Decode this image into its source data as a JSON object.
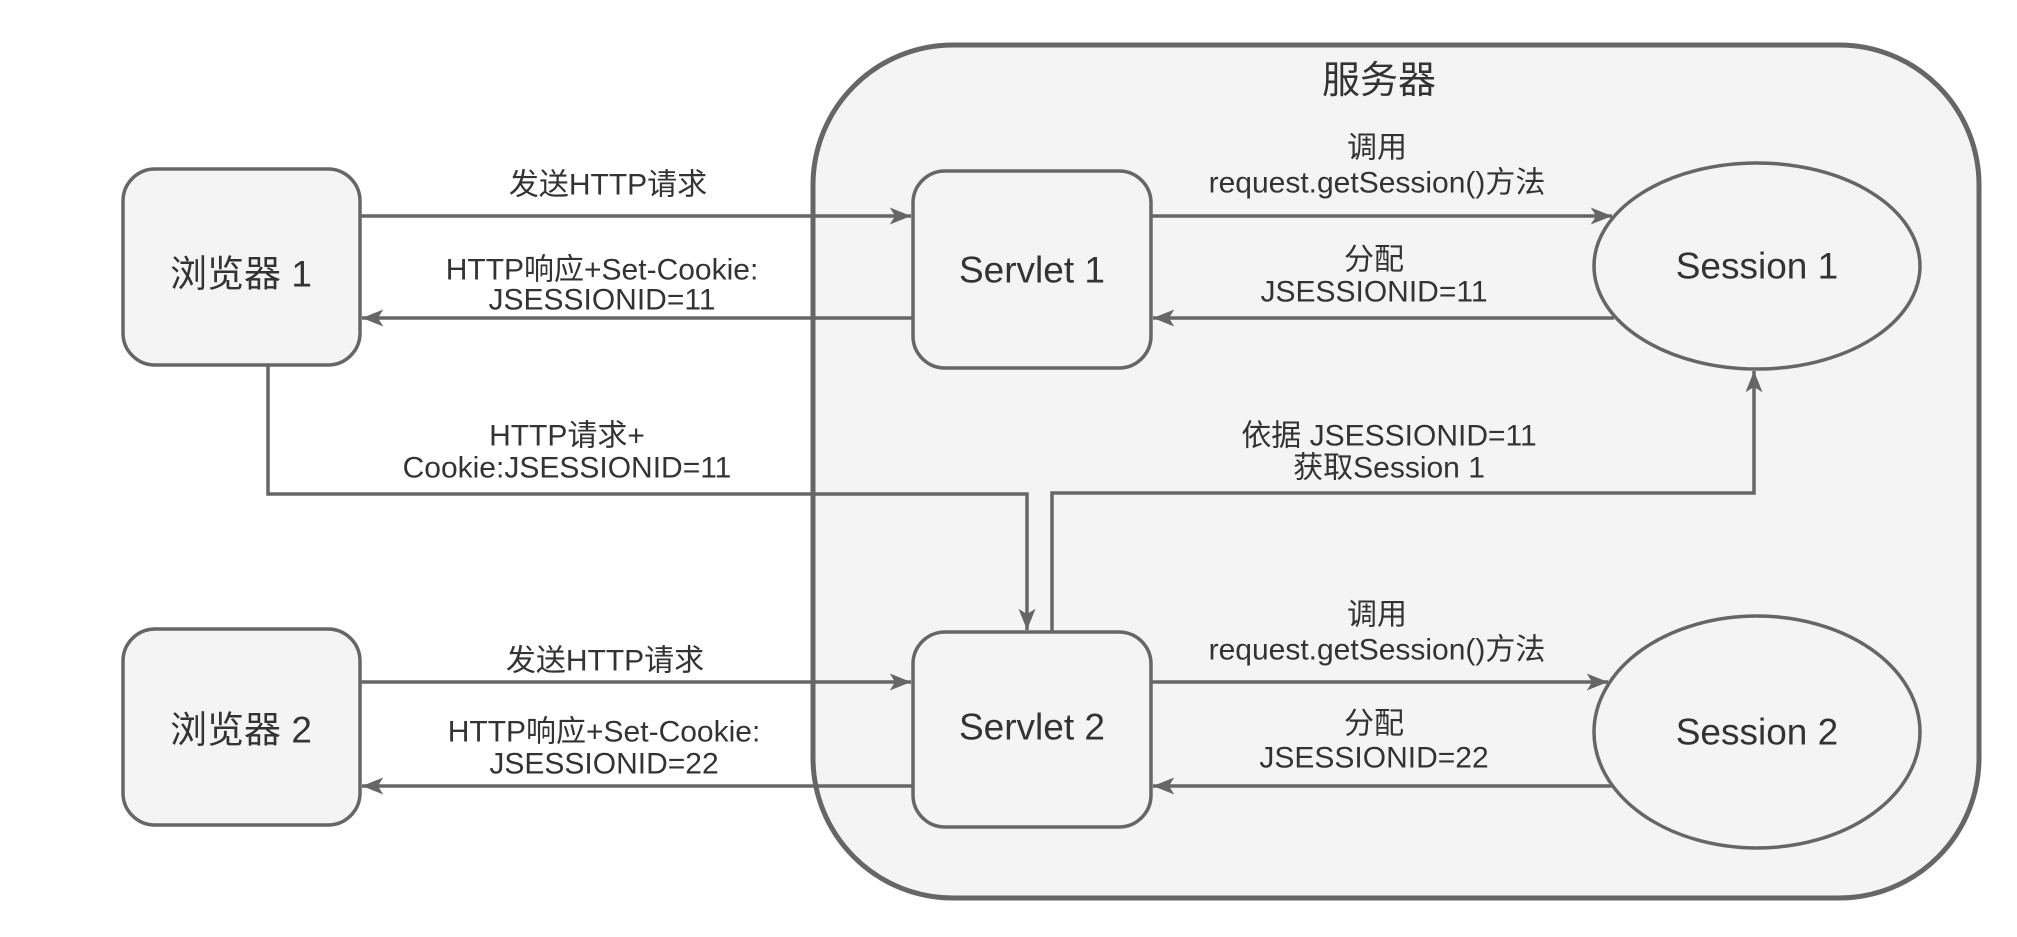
{
  "server": {
    "title": "服务器"
  },
  "browsers": [
    {
      "label": "浏览器 1"
    },
    {
      "label": "浏览器 2"
    }
  ],
  "servlets": [
    {
      "label": "Servlet 1"
    },
    {
      "label": "Servlet 2"
    }
  ],
  "sessions": [
    {
      "label": "Session 1"
    },
    {
      "label": "Session 2"
    }
  ],
  "edges": {
    "browser1_request": {
      "line1": "发送HTTP请求"
    },
    "browser1_response": {
      "line1": "HTTP响应+Set-Cookie:",
      "line2": "JSESSIONID=11"
    },
    "servlet1_call": {
      "line1": "调用",
      "line2": "request.getSession()方法"
    },
    "session1_assign": {
      "line1": "分配",
      "line2": "JSESSIONID=11"
    },
    "browser1_cookie_request": {
      "line1": "HTTP请求+",
      "line2": "Cookie:JSESSIONID=11"
    },
    "servlet2_lookup": {
      "line1": "依据 JSESSIONID=11",
      "line2": "获取Session 1"
    },
    "browser2_request": {
      "line1": "发送HTTP请求"
    },
    "browser2_response": {
      "line1": "HTTP响应+Set-Cookie:",
      "line2": "JSESSIONID=22"
    },
    "servlet2_call": {
      "line1": "调用",
      "line2": "request.getSession()方法"
    },
    "session2_assign": {
      "line1": "分配",
      "line2": "JSESSIONID=22"
    }
  },
  "colors": {
    "stroke": "#666666",
    "container_fill": "#f4f4f4",
    "node_fill": "#f4f4f4",
    "text": "#333333"
  }
}
